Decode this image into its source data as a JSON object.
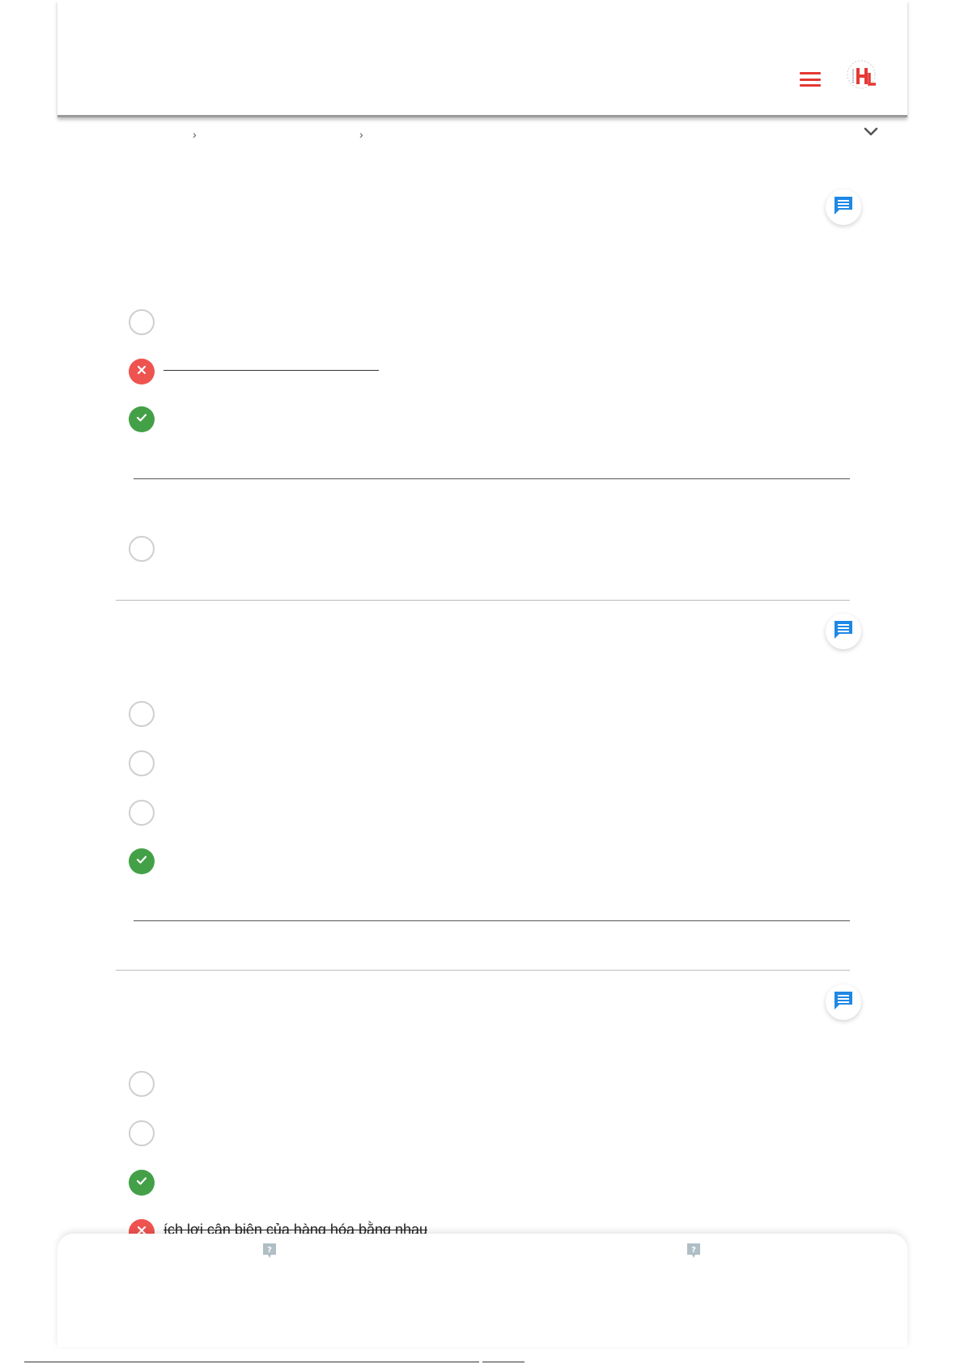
{
  "header": {
    "menu_icon": "hamburger-menu-icon",
    "logo_icon": "hl-logo-icon",
    "accent_color": "#e53935"
  },
  "breadcrumb": {
    "separator": "›",
    "toggle_icon": "chevron-down-icon"
  },
  "questions": [
    {
      "comment_icon": "comment-icon",
      "options": [
        {
          "state": "unselected"
        },
        {
          "state": "wrong"
        },
        {
          "state": "correct"
        },
        {
          "state": "unselected"
        }
      ]
    },
    {
      "comment_icon": "comment-icon",
      "options": [
        {
          "state": "unselected"
        },
        {
          "state": "unselected"
        },
        {
          "state": "unselected"
        },
        {
          "state": "correct"
        }
      ]
    },
    {
      "comment_icon": "comment-icon",
      "options": [
        {
          "state": "unselected"
        },
        {
          "state": "unselected"
        },
        {
          "state": "correct"
        },
        {
          "state": "wrong",
          "text": "ích lợi cận biên của hàng hóa bằng nhau"
        }
      ]
    }
  ],
  "colors": {
    "correct": "#43a047",
    "wrong": "#ef5350",
    "comment": "#1e88e5",
    "help": "#b0bec5"
  },
  "bottom_panel": {
    "left_help_icon": "help-icon",
    "right_help_icon": "help-icon"
  }
}
